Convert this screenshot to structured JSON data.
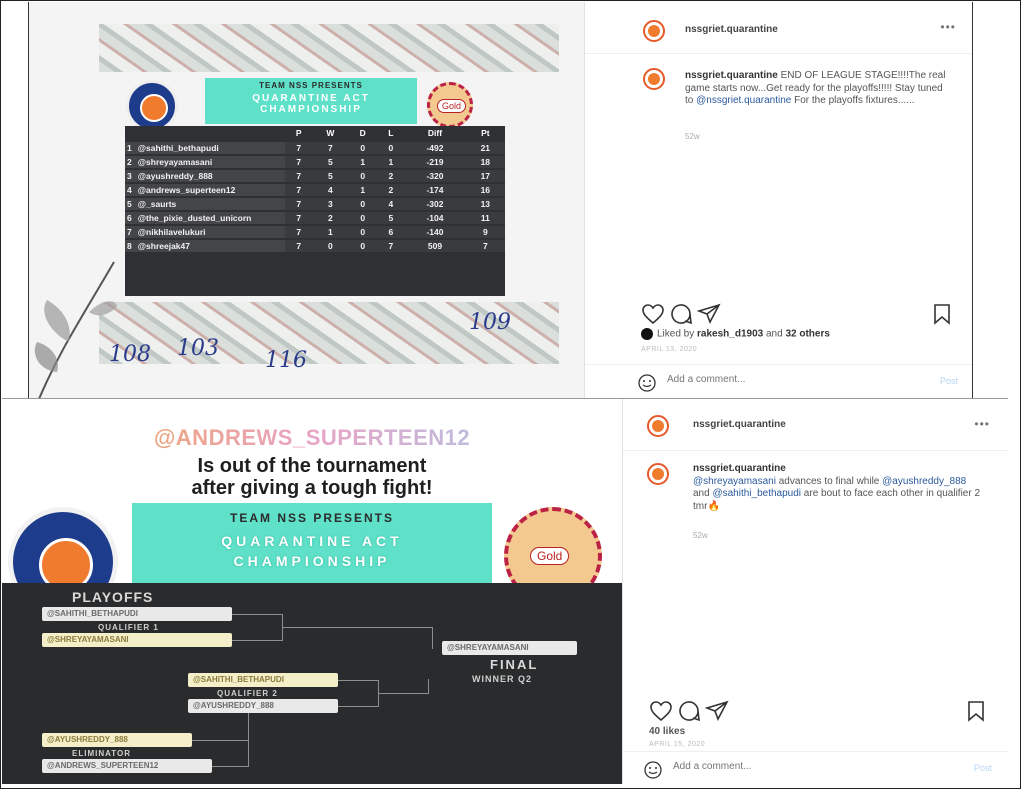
{
  "post1": {
    "image": {
      "banner_line1": "TEAM NSS PRESENTS",
      "banner_line2": "QUARANTINE ACT CHAMPIONSHIP",
      "logo_badge": "Gold",
      "handwriting": [
        "109",
        "108",
        "103",
        "116"
      ],
      "standings": {
        "columns": [
          "",
          "P",
          "W",
          "D",
          "L",
          "Diff",
          "Pt"
        ],
        "rows": [
          {
            "rank": "1",
            "name": "@sahithi_bethapudi",
            "p": "7",
            "w": "7",
            "d": "0",
            "l": "0",
            "diff": "-492",
            "pt": "21"
          },
          {
            "rank": "2",
            "name": "@shreyayamasani",
            "p": "7",
            "w": "5",
            "d": "1",
            "l": "1",
            "diff": "-219",
            "pt": "18"
          },
          {
            "rank": "3",
            "name": "@ayushreddy_888",
            "p": "7",
            "w": "5",
            "d": "0",
            "l": "2",
            "diff": "-320",
            "pt": "17"
          },
          {
            "rank": "4",
            "name": "@andrews_superteen12",
            "p": "7",
            "w": "4",
            "d": "1",
            "l": "2",
            "diff": "-174",
            "pt": "16"
          },
          {
            "rank": "5",
            "name": "@_saurts",
            "p": "7",
            "w": "3",
            "d": "0",
            "l": "4",
            "diff": "-302",
            "pt": "13"
          },
          {
            "rank": "6",
            "name": "@the_pixie_dusted_unicorn",
            "p": "7",
            "w": "2",
            "d": "0",
            "l": "5",
            "diff": "-104",
            "pt": "11"
          },
          {
            "rank": "7",
            "name": "@nikhilavelukuri",
            "p": "7",
            "w": "1",
            "d": "0",
            "l": "6",
            "diff": "-140",
            "pt": "9"
          },
          {
            "rank": "8",
            "name": "@shreejak47",
            "p": "7",
            "w": "0",
            "d": "0",
            "l": "7",
            "diff": "509",
            "pt": "7"
          }
        ]
      }
    },
    "side": {
      "username": "nssgriet.quarantine",
      "more": "•••",
      "caption_user": "nssgriet.quarantine",
      "caption_text": "END OF LEAGUE STAGE!!!!The real game starts now...Get ready for the playoffs!!!!! Stay tuned to ",
      "caption_mention": "@nssgriet.quarantine",
      "caption_tail": " For the playoffs fixtures......",
      "ago": "52w",
      "likes_prefix": "Liked by ",
      "likes_user": "rakesh_d1903",
      "likes_mid": " and ",
      "likes_others": "32 others",
      "date": "APRIL 13, 2020",
      "comment_placeholder": "Add a comment...",
      "post_label": "Post"
    }
  },
  "post2": {
    "image": {
      "headline_user": "@ANDREWS_SUPERTEEN12",
      "headline_line1": "Is out of the tournament",
      "headline_line2": "after giving a tough fight!",
      "banner_line1": "TEAM NSS PRESENTS",
      "banner_line2": "QUARANTINE ACT",
      "banner_line3": "CHAMPIONSHIP",
      "logo_badge": "Gold",
      "bracket": {
        "title": "PLAYOFFS",
        "qualifier1_top": "@SAHITHI_BETHAPUDI",
        "qualifier1_label": "QUALIFIER 1",
        "qualifier1_bottom": "@SHREYAYAMASANI",
        "final_slot": "@SHREYAYAMASANI",
        "final_label": "FINAL",
        "winner_label": "WINNER Q2",
        "qualifier2_top": "@SAHITHI_BETHAPUDI",
        "qualifier2_label": "QUALIFIER 2",
        "qualifier2_bottom": "@AYUSHREDDY_888",
        "eliminator_top": "@AYUSHREDDY_888",
        "eliminator_label": "ELIMINATOR",
        "eliminator_bottom": "@ANDREWS_SUPERTEEN12"
      }
    },
    "side": {
      "username": "nssgriet.quarantine",
      "more": "•••",
      "caption_user": "nssgriet.quarantine",
      "caption_mention1": "@shreyayamasani",
      "caption_text1": " advances to final while ",
      "caption_mention2": "@ayushreddy_888",
      "caption_text2": " and ",
      "caption_mention3": "@sahithi_bethapudi",
      "caption_text3": " are bout to face each other in qualifier 2 tmr🔥",
      "ago": "52w",
      "likes": "40 likes",
      "date": "APRIL 15, 2020",
      "comment_placeholder": "Add a comment...",
      "post_label": "Post"
    }
  }
}
